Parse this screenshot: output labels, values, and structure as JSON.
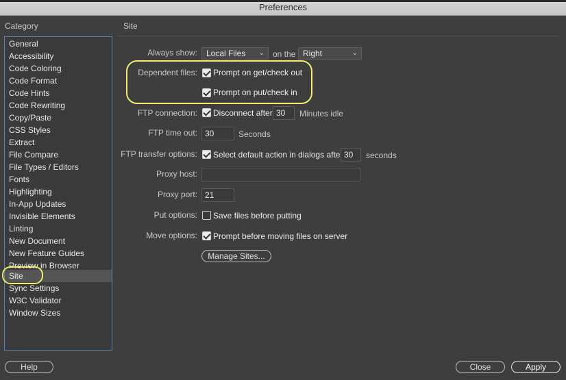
{
  "window": {
    "title": "Preferences"
  },
  "category_header": "Category",
  "section_title": "Site",
  "categories": [
    "General",
    "Accessibility",
    "Code Coloring",
    "Code Format",
    "Code Hints",
    "Code Rewriting",
    "Copy/Paste",
    "CSS Styles",
    "Extract",
    "File Compare",
    "File Types / Editors",
    "Fonts",
    "Highlighting",
    "In-App Updates",
    "Invisible Elements",
    "Linting",
    "New Document",
    "New Feature Guides",
    "Preview in Browser",
    "Site",
    "Sync Settings",
    "W3C Validator",
    "Window Sizes"
  ],
  "selected_category": "Site",
  "site": {
    "always_show": {
      "label": "Always show:",
      "value": "Local Files",
      "on_the": "on the",
      "side": "Right"
    },
    "dependent_files": {
      "label": "Dependent files:",
      "get_checkout": {
        "text": "Prompt on get/check out",
        "checked": true
      },
      "put_checkin": {
        "text": "Prompt on put/check in",
        "checked": true
      }
    },
    "ftp_connection": {
      "label": "FTP connection:",
      "text": "Disconnect after",
      "checked": true,
      "value": "30",
      "suffix": "Minutes idle"
    },
    "ftp_timeout": {
      "label": "FTP time out:",
      "value": "30",
      "suffix": "Seconds"
    },
    "ftp_transfer": {
      "label": "FTP transfer options:",
      "text": "Select default action in dialogs after",
      "checked": true,
      "value": "30",
      "suffix": "seconds"
    },
    "proxy_host": {
      "label": "Proxy host:",
      "value": ""
    },
    "proxy_port": {
      "label": "Proxy port:",
      "value": "21"
    },
    "put_options": {
      "label": "Put options:",
      "text": "Save files before putting",
      "checked": false
    },
    "move_options": {
      "label": "Move options:",
      "text": "Prompt before moving files on server",
      "checked": true
    },
    "manage_sites": "Manage Sites..."
  },
  "footer": {
    "help": "Help",
    "close": "Close",
    "apply": "Apply"
  },
  "colors": {
    "background": "#3e3e3e",
    "highlight": "#f2ee6a",
    "list_border": "#5a7fb0"
  }
}
